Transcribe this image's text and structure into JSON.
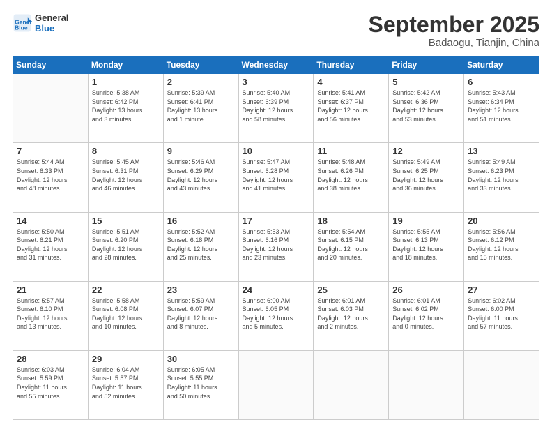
{
  "header": {
    "logo_line1": "General",
    "logo_line2": "Blue",
    "month": "September 2025",
    "location": "Badaogu, Tianjin, China"
  },
  "weekdays": [
    "Sunday",
    "Monday",
    "Tuesday",
    "Wednesday",
    "Thursday",
    "Friday",
    "Saturday"
  ],
  "weeks": [
    [
      {
        "day": "",
        "info": ""
      },
      {
        "day": "1",
        "info": "Sunrise: 5:38 AM\nSunset: 6:42 PM\nDaylight: 13 hours\nand 3 minutes."
      },
      {
        "day": "2",
        "info": "Sunrise: 5:39 AM\nSunset: 6:41 PM\nDaylight: 13 hours\nand 1 minute."
      },
      {
        "day": "3",
        "info": "Sunrise: 5:40 AM\nSunset: 6:39 PM\nDaylight: 12 hours\nand 58 minutes."
      },
      {
        "day": "4",
        "info": "Sunrise: 5:41 AM\nSunset: 6:37 PM\nDaylight: 12 hours\nand 56 minutes."
      },
      {
        "day": "5",
        "info": "Sunrise: 5:42 AM\nSunset: 6:36 PM\nDaylight: 12 hours\nand 53 minutes."
      },
      {
        "day": "6",
        "info": "Sunrise: 5:43 AM\nSunset: 6:34 PM\nDaylight: 12 hours\nand 51 minutes."
      }
    ],
    [
      {
        "day": "7",
        "info": "Sunrise: 5:44 AM\nSunset: 6:33 PM\nDaylight: 12 hours\nand 48 minutes."
      },
      {
        "day": "8",
        "info": "Sunrise: 5:45 AM\nSunset: 6:31 PM\nDaylight: 12 hours\nand 46 minutes."
      },
      {
        "day": "9",
        "info": "Sunrise: 5:46 AM\nSunset: 6:29 PM\nDaylight: 12 hours\nand 43 minutes."
      },
      {
        "day": "10",
        "info": "Sunrise: 5:47 AM\nSunset: 6:28 PM\nDaylight: 12 hours\nand 41 minutes."
      },
      {
        "day": "11",
        "info": "Sunrise: 5:48 AM\nSunset: 6:26 PM\nDaylight: 12 hours\nand 38 minutes."
      },
      {
        "day": "12",
        "info": "Sunrise: 5:49 AM\nSunset: 6:25 PM\nDaylight: 12 hours\nand 36 minutes."
      },
      {
        "day": "13",
        "info": "Sunrise: 5:49 AM\nSunset: 6:23 PM\nDaylight: 12 hours\nand 33 minutes."
      }
    ],
    [
      {
        "day": "14",
        "info": "Sunrise: 5:50 AM\nSunset: 6:21 PM\nDaylight: 12 hours\nand 31 minutes."
      },
      {
        "day": "15",
        "info": "Sunrise: 5:51 AM\nSunset: 6:20 PM\nDaylight: 12 hours\nand 28 minutes."
      },
      {
        "day": "16",
        "info": "Sunrise: 5:52 AM\nSunset: 6:18 PM\nDaylight: 12 hours\nand 25 minutes."
      },
      {
        "day": "17",
        "info": "Sunrise: 5:53 AM\nSunset: 6:16 PM\nDaylight: 12 hours\nand 23 minutes."
      },
      {
        "day": "18",
        "info": "Sunrise: 5:54 AM\nSunset: 6:15 PM\nDaylight: 12 hours\nand 20 minutes."
      },
      {
        "day": "19",
        "info": "Sunrise: 5:55 AM\nSunset: 6:13 PM\nDaylight: 12 hours\nand 18 minutes."
      },
      {
        "day": "20",
        "info": "Sunrise: 5:56 AM\nSunset: 6:12 PM\nDaylight: 12 hours\nand 15 minutes."
      }
    ],
    [
      {
        "day": "21",
        "info": "Sunrise: 5:57 AM\nSunset: 6:10 PM\nDaylight: 12 hours\nand 13 minutes."
      },
      {
        "day": "22",
        "info": "Sunrise: 5:58 AM\nSunset: 6:08 PM\nDaylight: 12 hours\nand 10 minutes."
      },
      {
        "day": "23",
        "info": "Sunrise: 5:59 AM\nSunset: 6:07 PM\nDaylight: 12 hours\nand 8 minutes."
      },
      {
        "day": "24",
        "info": "Sunrise: 6:00 AM\nSunset: 6:05 PM\nDaylight: 12 hours\nand 5 minutes."
      },
      {
        "day": "25",
        "info": "Sunrise: 6:01 AM\nSunset: 6:03 PM\nDaylight: 12 hours\nand 2 minutes."
      },
      {
        "day": "26",
        "info": "Sunrise: 6:01 AM\nSunset: 6:02 PM\nDaylight: 12 hours\nand 0 minutes."
      },
      {
        "day": "27",
        "info": "Sunrise: 6:02 AM\nSunset: 6:00 PM\nDaylight: 11 hours\nand 57 minutes."
      }
    ],
    [
      {
        "day": "28",
        "info": "Sunrise: 6:03 AM\nSunset: 5:59 PM\nDaylight: 11 hours\nand 55 minutes."
      },
      {
        "day": "29",
        "info": "Sunrise: 6:04 AM\nSunset: 5:57 PM\nDaylight: 11 hours\nand 52 minutes."
      },
      {
        "day": "30",
        "info": "Sunrise: 6:05 AM\nSunset: 5:55 PM\nDaylight: 11 hours\nand 50 minutes."
      },
      {
        "day": "",
        "info": ""
      },
      {
        "day": "",
        "info": ""
      },
      {
        "day": "",
        "info": ""
      },
      {
        "day": "",
        "info": ""
      }
    ]
  ]
}
